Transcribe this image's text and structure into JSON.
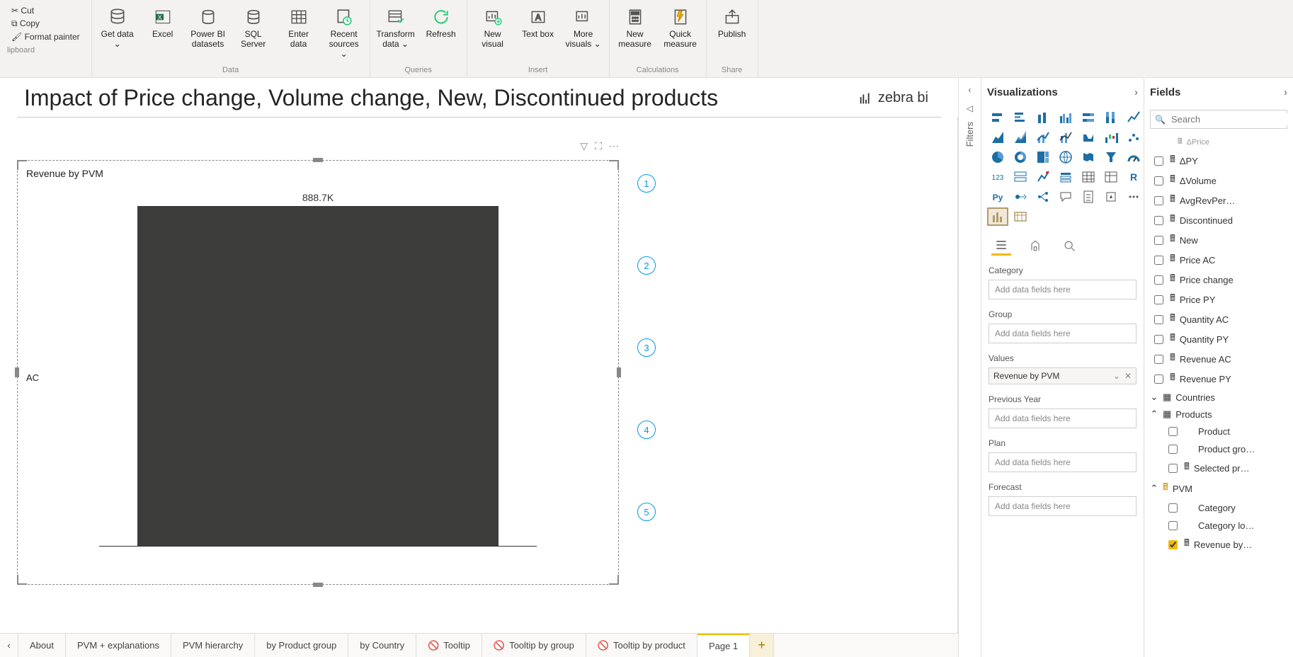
{
  "clipboard": {
    "cut": "Cut",
    "copy": "Copy",
    "format_painter": "Format painter",
    "group": "lipboard"
  },
  "ribbon": {
    "data": {
      "get_data": "Get data ⌄",
      "excel": "Excel",
      "pbi_datasets": "Power BI datasets",
      "sql": "SQL Server",
      "enter": "Enter data",
      "recent": "Recent sources ⌄",
      "group": "Data"
    },
    "queries": {
      "transform": "Transform data ⌄",
      "refresh": "Refresh",
      "group": "Queries"
    },
    "insert": {
      "new_visual": "New visual",
      "text_box": "Text box",
      "more_visuals": "More visuals ⌄",
      "group": "Insert"
    },
    "calc": {
      "new_measure": "New measure",
      "quick_measure": "Quick measure",
      "group": "Calculations"
    },
    "share": {
      "publish": "Publish",
      "group": "Share"
    }
  },
  "page": {
    "title": "Impact of Price change, Volume change, New, Discontinued products",
    "logo": "zebra bi"
  },
  "visual": {
    "title": "Revenue by PVM",
    "bar_value": "888.7K",
    "ylabel": "AC",
    "header_icons": [
      "filter-icon",
      "focus-mode-icon",
      "more-options-icon"
    ]
  },
  "chart_data": {
    "type": "bar",
    "categories": [
      "AC"
    ],
    "values": [
      888700
    ],
    "value_labels": [
      "888.7K"
    ],
    "title": "Revenue by PVM",
    "xlabel": "",
    "ylabel": "",
    "ylim": [
      0,
      900000
    ]
  },
  "circles": [
    "1",
    "2",
    "3",
    "4",
    "5"
  ],
  "filters": {
    "label": "Filters"
  },
  "viz": {
    "header": "Visualizations",
    "wells": {
      "category": {
        "label": "Category",
        "placeholder": "Add data fields here"
      },
      "group": {
        "label": "Group",
        "placeholder": "Add data fields here"
      },
      "values": {
        "label": "Values",
        "chip": "Revenue by PVM"
      },
      "py": {
        "label": "Previous Year",
        "placeholder": "Add data fields here"
      },
      "plan": {
        "label": "Plan",
        "placeholder": "Add data fields here"
      },
      "forecast": {
        "label": "Forecast",
        "placeholder": "Add data fields here"
      }
    }
  },
  "fields": {
    "header": "Fields",
    "search_placeholder": "Search",
    "measures": [
      {
        "name": "ΔPrice",
        "checked": false,
        "cut": true
      },
      {
        "name": "ΔPY",
        "checked": false
      },
      {
        "name": "ΔVolume",
        "checked": false
      },
      {
        "name": "AvgRevPer…",
        "checked": false
      },
      {
        "name": "Discontinued",
        "checked": false
      },
      {
        "name": "New",
        "checked": false
      },
      {
        "name": "Price AC",
        "checked": false
      },
      {
        "name": "Price change",
        "checked": false
      },
      {
        "name": "Price PY",
        "checked": false
      },
      {
        "name": "Quantity AC",
        "checked": false
      },
      {
        "name": "Quantity PY",
        "checked": false
      },
      {
        "name": "Revenue AC",
        "checked": false
      },
      {
        "name": "Revenue PY",
        "checked": false
      }
    ],
    "tables": [
      {
        "name": "Countries",
        "expanded": false,
        "children": []
      },
      {
        "name": "Products",
        "expanded": true,
        "children": [
          {
            "name": "Product",
            "checked": false,
            "icon": "none"
          },
          {
            "name": "Product gro…",
            "checked": false,
            "icon": "none"
          },
          {
            "name": "Selected pr…",
            "checked": false,
            "icon": "calc"
          }
        ]
      },
      {
        "name": "PVM",
        "expanded": true,
        "icon": "calc-table",
        "children": [
          {
            "name": "Category",
            "checked": false,
            "icon": "none"
          },
          {
            "name": "Category lo…",
            "checked": false,
            "icon": "none"
          },
          {
            "name": "Revenue by…",
            "checked": true,
            "icon": "calc"
          }
        ]
      }
    ]
  },
  "tabs": [
    {
      "label": "About"
    },
    {
      "label": "PVM + explanations"
    },
    {
      "label": "PVM hierarchy"
    },
    {
      "label": "by Product group"
    },
    {
      "label": "by Country"
    },
    {
      "label": "Tooltip",
      "hidden": true
    },
    {
      "label": "Tooltip by group",
      "hidden": true
    },
    {
      "label": "Tooltip by product",
      "hidden": true
    },
    {
      "label": "Page 1",
      "active": true
    }
  ]
}
